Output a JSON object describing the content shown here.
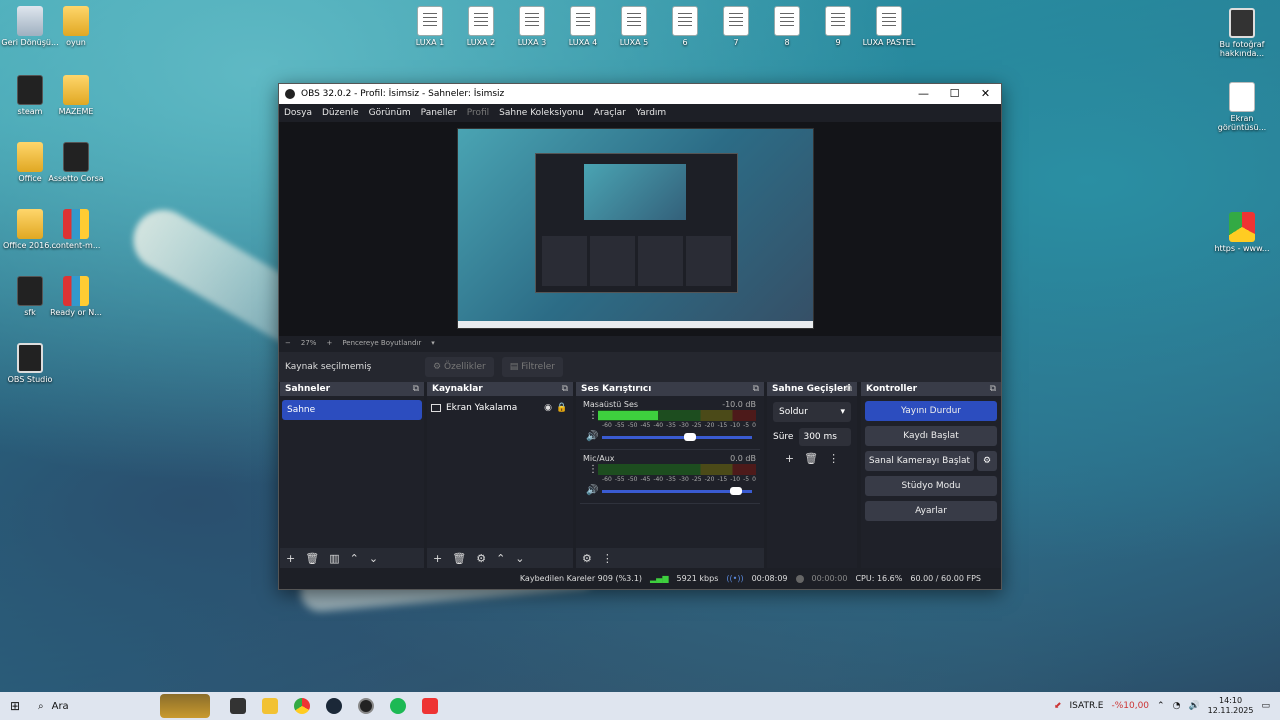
{
  "desktop": {
    "left_icons": [
      {
        "label": "Geri Dönüşü...",
        "kind": "recycle"
      },
      {
        "label": "oyun",
        "kind": "folder"
      },
      {
        "label": "steam",
        "kind": "dark"
      },
      {
        "label": "MAZEME",
        "kind": "folder"
      },
      {
        "label": "Office",
        "kind": "folder"
      },
      {
        "label": "Assetto Corsa",
        "kind": "dark"
      },
      {
        "label": "Office 2016...",
        "kind": "folder"
      },
      {
        "label": "content-m...",
        "kind": "rar"
      },
      {
        "label": "sfk",
        "kind": "dark"
      },
      {
        "label": "Ready or N...",
        "kind": "rar"
      },
      {
        "label": "OBS Studio",
        "kind": "obs"
      }
    ],
    "top_icons": [
      "LUXA 1",
      "LUXA 2",
      "LUXA 3",
      "LUXA 4",
      "LUXA 5",
      "6",
      "7",
      "8",
      "9",
      "LUXA PASTEL"
    ],
    "right_icons": [
      {
        "label": "Bu fotoğraf hakkında...",
        "kind": "cam"
      },
      {
        "label": "Ekran görüntüsü...",
        "kind": "white"
      },
      {
        "label": "https - www...",
        "kind": "chrome"
      }
    ]
  },
  "obs": {
    "title": "OBS 32.0.2 - Profil: İsimsiz - Sahneler: İsimsiz",
    "window_buttons": {
      "minimize": "—",
      "maximize": "☐",
      "close": "✕"
    },
    "menu": [
      "Dosya",
      "Düzenle",
      "Görünüm",
      "Paneller",
      "Profil",
      "Sahne Koleksiyonu",
      "Araçlar",
      "Yardım"
    ],
    "menu_disabled": "Profil",
    "zoom": {
      "minus": "−",
      "value": "27%",
      "plus": "+",
      "mode": "Pencereye Boyutlandır",
      "caret": "▾"
    },
    "source_bar": {
      "no_selection": "Kaynak seçilmemiş",
      "properties": "Özellikler",
      "filters": "Filtreler"
    },
    "docks": {
      "scenes": {
        "title": "Sahneler",
        "items": [
          "Sahne"
        ]
      },
      "sources": {
        "title": "Kaynaklar",
        "items": [
          "Ekran Yakalama"
        ]
      },
      "mixer": {
        "title": "Ses Karıştırıcı",
        "channels": [
          {
            "name": "Masaüstü Ses",
            "db": "-10.0 dB",
            "level": 0.38,
            "fader": 0.64
          },
          {
            "name": "Mic/Aux",
            "db": "0.0 dB",
            "level": 0.0,
            "fader": 1.0
          }
        ],
        "ticks": [
          "-60",
          "-55",
          "-50",
          "-45",
          "-40",
          "-35",
          "-30",
          "-25",
          "-20",
          "-15",
          "-10",
          "-5",
          "0"
        ]
      },
      "transitions": {
        "title": "Sahne Geçişleri",
        "selected": "Soldur",
        "duration_label": "Süre",
        "duration": "300 ms"
      },
      "controls": {
        "title": "Kontroller",
        "stop_stream": "Yayını Durdur",
        "start_record": "Kaydı Başlat",
        "virtual_cam": "Sanal Kamerayı Başlat",
        "studio_mode": "Stüdyo Modu",
        "settings": "Ayarlar"
      }
    },
    "status": {
      "dropped": "Kaybedilen Kareler 909 (%3.1)",
      "bitrate": "5921 kbps",
      "stream_time": "00:08:09",
      "rec_time": "00:00:00",
      "cpu": "CPU: 16.6%",
      "fps": "60.00 / 60.00 FPS"
    }
  },
  "taskbar": {
    "search_label": "Ara",
    "stock_name": "ISATR.E",
    "stock_change": "-%10,00",
    "time": "14:10",
    "date": "12.11.2025"
  },
  "colors": {
    "accent": "#2c4dbf",
    "meter_green": "#3ecf3e"
  }
}
